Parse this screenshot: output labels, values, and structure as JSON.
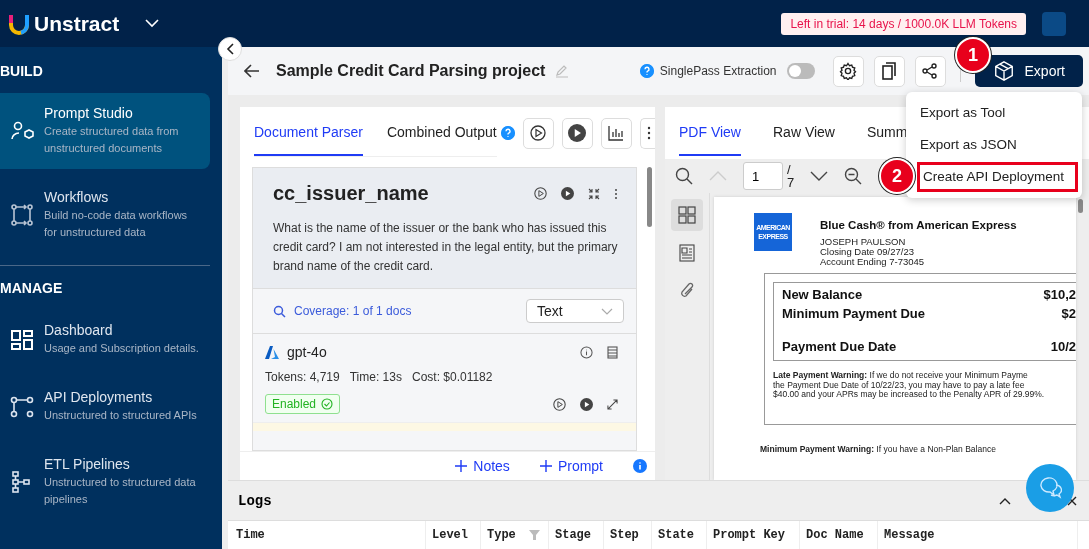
{
  "topbar": {
    "brand": "Unstract",
    "trial_badge": "Left in trial: 14 days / 1000.0K LLM Tokens"
  },
  "sidebar": {
    "sections": [
      {
        "title": "BUILD",
        "items": [
          {
            "kind": "prompt",
            "label": "Prompt Studio",
            "description": "Create structured data from unstructured documents",
            "selected": true
          },
          {
            "kind": "workflow",
            "label": "Workflows",
            "description": "Build no-code data workflows for unstructured data",
            "selected": false
          }
        ]
      },
      {
        "title": "MANAGE",
        "items": [
          {
            "kind": "dashboard",
            "label": "Dashboard",
            "description": "Usage and Subscription details.",
            "selected": false
          },
          {
            "kind": "api",
            "label": "API Deployments",
            "description": "Unstructured to structured APIs",
            "selected": false
          },
          {
            "kind": "etl",
            "label": "ETL Pipelines",
            "description": "Unstructured to structured data pipelines",
            "selected": false
          }
        ]
      }
    ]
  },
  "header": {
    "title": "Sample Credit Card Parsing project",
    "singlepass": {
      "label": "SinglePass Extraction",
      "on": false
    },
    "export_button": "Export"
  },
  "export_menu": [
    {
      "label": "Export as Tool",
      "highlighted": false
    },
    {
      "label": "Export as JSON",
      "highlighted": false
    },
    {
      "label": "Create API Deployment",
      "highlighted": true
    }
  ],
  "step_markers": [
    "1",
    "2"
  ],
  "left_panel": {
    "tabs": [
      {
        "label": "Document Parser",
        "selected": true
      },
      {
        "label": "Combined Output",
        "selected": false
      }
    ],
    "prompt_card": {
      "key": "cc_issuer_name",
      "question": "What is the name of the issuer or the bank who has issued this credit card? I am not interested in the legal entity, but the primary brand name of the credit card.",
      "coverage": "Coverage: 1 of 1 docs",
      "output_type": "Text",
      "llm": {
        "name": "gpt-4o",
        "tokens": "Tokens: 4,719",
        "time": "Time: 13s",
        "cost": "Cost: $0.01182",
        "status": "Enabled"
      }
    },
    "footer": {
      "notes": "Notes",
      "prompt": "Prompt"
    }
  },
  "right_panel": {
    "tabs": [
      {
        "label": "PDF View",
        "selected": true
      },
      {
        "label": "Raw View",
        "selected": false
      },
      {
        "label": "Summ",
        "selected": false
      }
    ],
    "page_input": "1",
    "page_sep": "/",
    "page_total": "7",
    "document": {
      "logo_lines": [
        "AMERICAN",
        "EXPRESS"
      ],
      "title": "Blue Cash® from American Express",
      "holder": [
        "JOSEPH PAULSON",
        "Closing Date 09/27/23",
        "Account Ending 7-73045"
      ],
      "summary": [
        {
          "label": "New Balance",
          "value": "$10,2"
        },
        {
          "label": "Minimum Payment Due",
          "value": "$2"
        },
        {
          "label": "Payment Due Date",
          "value": "10/2"
        }
      ],
      "late_warning": [
        "**Late Payment Warning:** If we do not receive your Minimum Payme",
        "the Payment Due Date of 10/22/23, you may have to pay a late fee",
        "$40.00 and your APRs may be increased to the Penalty APR of 29.99%."
      ],
      "min_warning": "**Minimum Payment Warning:** If you have a Non-Plan Balance"
    }
  },
  "logs": {
    "title": "Logs",
    "columns": [
      {
        "label": "Time",
        "kind": "plain"
      },
      {
        "label": "Level",
        "kind": "plain"
      },
      {
        "label": "Type",
        "kind": "filterable"
      },
      {
        "label": "Stage",
        "kind": "plain"
      },
      {
        "label": "Step",
        "kind": "plain"
      },
      {
        "label": "State",
        "kind": "plain"
      },
      {
        "label": "Prompt Key",
        "kind": "plain"
      },
      {
        "label": "Doc Name",
        "kind": "plain"
      },
      {
        "label": "Message",
        "kind": "plain"
      }
    ]
  }
}
